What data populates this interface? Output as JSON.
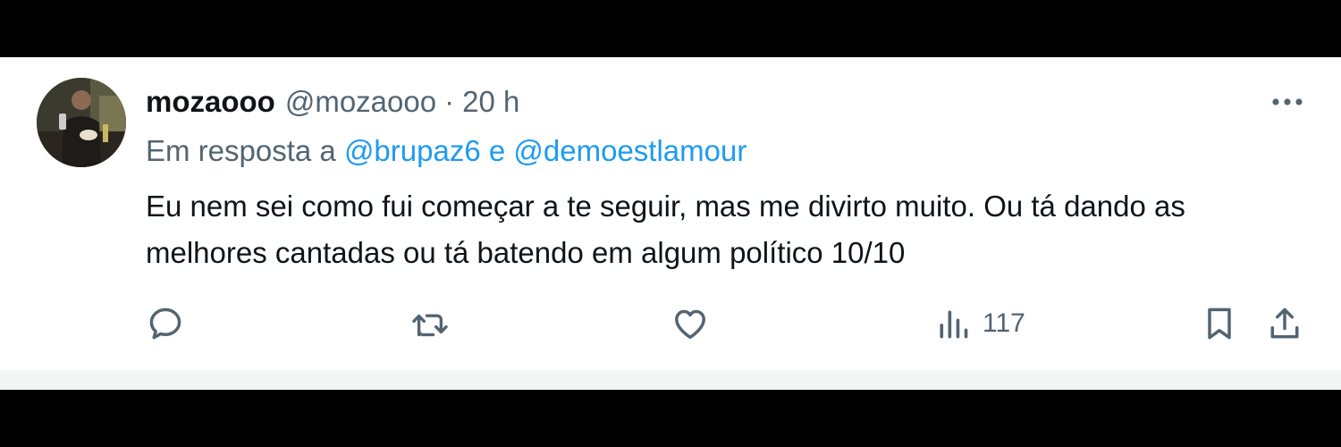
{
  "tweet": {
    "author_name": "mozaooo",
    "author_handle": "@mozaooo",
    "separator": "·",
    "time": "20 h",
    "reply_prefix": "Em resposta a",
    "reply_mention_1": "@brupaz6",
    "reply_joiner": "e",
    "reply_mention_2": "@demoestlamour",
    "text": "Eu nem sei como fui começar a te seguir, mas me divirto muito. Ou tá dando as melhores cantadas ou tá batendo em algum político 10/10"
  },
  "actions": {
    "reply_icon": "reply-icon",
    "retweet_icon": "retweet-icon",
    "like_icon": "heart-icon",
    "views_icon": "views-icon",
    "views_count": "117",
    "bookmark_icon": "bookmark-icon",
    "share_icon": "share-icon",
    "more_icon": "more-icon"
  },
  "colors": {
    "text_primary": "#0f1419",
    "text_secondary": "#536471",
    "accent": "#1d9bf0",
    "background": "#ffffff",
    "frame": "#000000"
  }
}
